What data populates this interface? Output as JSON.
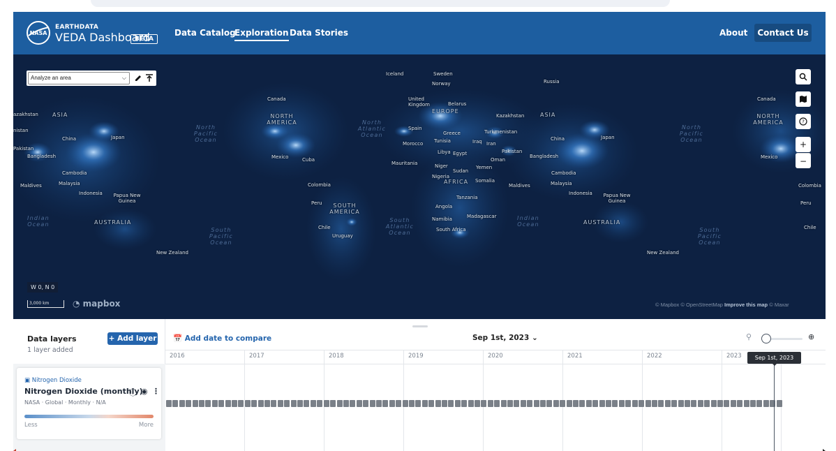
{
  "header": {
    "brand_top": "EARTHDATA",
    "brand_main": "VEDA Dashboard",
    "beta": "BETA",
    "nav": [
      "Data Catalog",
      "Exploration",
      "Data Stories"
    ],
    "active_nav": "Exploration",
    "about": "About",
    "contact": "Contact Us",
    "bar_color": "#1d5ea0"
  },
  "map_tools": {
    "analyze_select": "Analyze an area",
    "pencil_icon": "pencil-icon",
    "upload_icon": "upload-icon",
    "controls": [
      "search-icon",
      "map-layers-icon",
      "help-icon",
      "zoom-in-icon",
      "zoom-out-icon"
    ]
  },
  "map_labels": {
    "countries": [
      "Iceland",
      "Sweden",
      "Norway",
      "Russia",
      "Canada",
      "United Kingdom",
      "Belarus",
      "Kazakhstan",
      "Spain",
      "Greece",
      "Turkmenistan",
      "Morocco",
      "Tunisia",
      "Iraq",
      "Iran",
      "Libya",
      "Egypt",
      "Pakistan",
      "Bangladesh",
      "China",
      "Japan",
      "Mexico",
      "Cuba",
      "Mauritania",
      "Niger",
      "Sudan",
      "Yemen",
      "Oman",
      "Nigeria",
      "Somalia",
      "Maldives",
      "Malaysia",
      "Cambodia",
      "Indonesia",
      "Papua New Guinea",
      "Colombia",
      "Peru",
      "Tanzania",
      "Angola",
      "Namibia",
      "Madagascar",
      "South Africa",
      "Chile",
      "Uruguay",
      "New Zealand",
      "azakhstan",
      "nistan",
      "Pakistan",
      "Mexico",
      "Colombia",
      "Peru",
      "Chile"
    ],
    "continents": [
      "ASIA",
      "NORTH AMERICA",
      "EUROPE",
      "AFRICA",
      "SOUTH AMERICA",
      "AUSTRALIA",
      "ASIA",
      "NORTH AMERICA",
      "AUSTRALIA"
    ],
    "oceans": [
      "North Pacific Ocean",
      "North Atlantic Ocean",
      "Indian Ocean",
      "South Pacific Ocean",
      "South Atlantic Ocean",
      "Indian Ocean",
      "North Pacific Ocean",
      "South Pacific Ocean"
    ]
  },
  "map_footer": {
    "coords": "W 0, N 0",
    "scale": "3,000 km",
    "mapbox": "mapbox",
    "attribution_prefix": "© Mapbox © OpenStreetMap",
    "attribution_bold": "Improve this map",
    "attribution_suffix": "© Maxar"
  },
  "panel": {
    "data_layers_title": "Data layers",
    "layers_added": "1 layer added",
    "add_layer": "+ Add layer",
    "layer": {
      "dataset": "Nitrogen Dioxide",
      "name": "Nitrogen Dioxide (monthly)",
      "meta": "NASA · Global · Monthly · N/A",
      "less": "Less",
      "more": "More"
    },
    "add_compare": "Add date to compare",
    "selected_date": "Sep 1st, 2023",
    "tooltip": "Sep 1st, 2023",
    "years": [
      "2016",
      "2017",
      "2018",
      "2019",
      "2020",
      "2021",
      "2022",
      "2023"
    ]
  }
}
